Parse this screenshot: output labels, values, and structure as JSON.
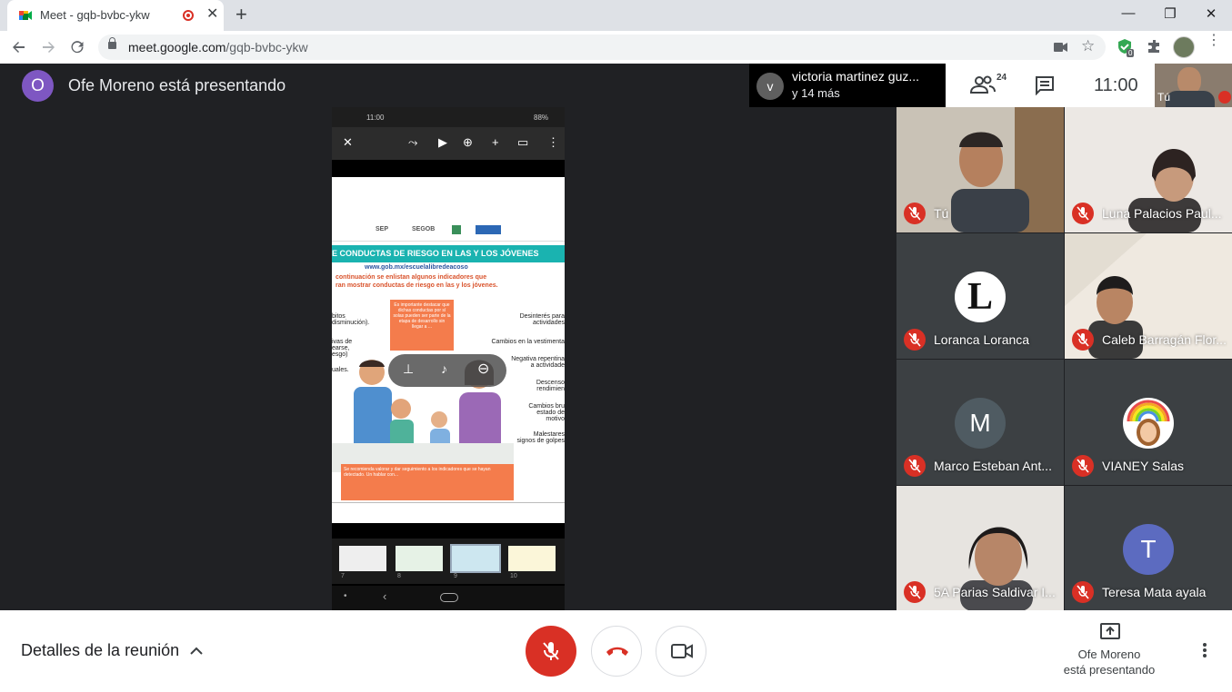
{
  "browser": {
    "tab_title": "Meet - gqb-bvbc-ykw",
    "url_host": "meet.google.com",
    "url_path": "/gqb-bvbc-ykw",
    "extension_badge": "0"
  },
  "presenter": {
    "avatar_letter": "O",
    "text": "Ofe Moreno está presentando"
  },
  "chat_notification": {
    "avatar_letter": "v",
    "line1": "victoria martinez guz...",
    "line2": "y 14 más"
  },
  "topbar": {
    "participants_count": "24",
    "time": "11:00",
    "self_label": "Tú"
  },
  "phone": {
    "status_time": "11:00",
    "status_battery": "88%",
    "slide_logos": [
      "SEP",
      "SEGOB"
    ],
    "slide_heading": "E CONDUCTAS DE RIESGO EN LAS Y LOS JÓVENES",
    "slide_url": "www.gob.mx/escuelalibredeacoso",
    "slide_intro": "continuación se enlistan algunos indicadores que\nran mostrar conductas de riesgo en las y los jóvenes.",
    "slide_callout": "Es importante destacar que dichas conductas por sí solas pueden ser parte de la etapa de desarrollo sin llegar a ...",
    "slide_left_items": [
      "bitos\ndisminución).",
      "ivas de\nearse,\nesgo)",
      "uales."
    ],
    "slide_right_items": [
      "Desinterés para\nactividades",
      "Cambios en la vestimenta",
      "Negativa repentina\na actividade",
      "Descenso\nrendimien",
      "Cambios bru\nestado de\nmotivo",
      "Malestares\nsignos de golpes"
    ],
    "slide_footer": "Se recomienda valorar y dar seguimiento a los indicadores que se hayan detectado. Un hablar con...",
    "thumb_numbers": [
      "7",
      "8",
      "9",
      "10"
    ]
  },
  "participants": [
    {
      "name": "Tú",
      "type": "video",
      "muted": true
    },
    {
      "name": "Luna Palacios Paul...",
      "type": "video",
      "muted": true
    },
    {
      "name": "Loranca Loranca",
      "type": "avatar",
      "letter": "L",
      "color": "#ffffff",
      "muted": true
    },
    {
      "name": "Caleb Barragán Flor...",
      "type": "video",
      "muted": true
    },
    {
      "name": "Marco Esteban Ant...",
      "type": "avatar",
      "letter": "M",
      "color": "#4f5b62",
      "muted": true
    },
    {
      "name": "VIANEY Salas",
      "type": "avatar",
      "letter": "",
      "color": "#ffffff",
      "muted": true
    },
    {
      "name": "5A Parias Saldivar I...",
      "type": "video",
      "muted": true
    },
    {
      "name": "Teresa Mata ayala",
      "type": "avatar",
      "letter": "T",
      "color": "#5c6bc0",
      "muted": true
    }
  ],
  "bottom": {
    "details_label": "Detalles de la reunión",
    "present_line1": "Ofe Moreno",
    "present_line2": "está presentando"
  },
  "colors": {
    "meet_background": "#202124",
    "danger_red": "#d93025",
    "presenter_avatar": "#7e57c2"
  },
  "icons": [
    "back-arrow-icon",
    "forward-arrow-icon",
    "reload-icon",
    "lock-icon",
    "camera-blocked-icon",
    "star-icon",
    "extension-icon",
    "people-icon",
    "chat-icon",
    "mic-off-icon",
    "hangup-icon",
    "camera-icon",
    "present-icon",
    "more-vert-icon",
    "chevron-up-icon"
  ]
}
